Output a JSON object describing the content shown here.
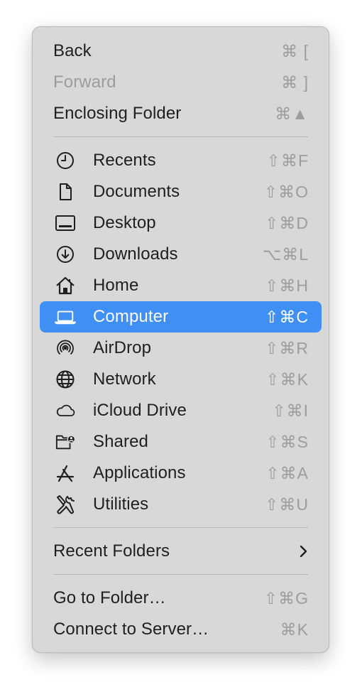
{
  "colors": {
    "menu_background": "#d8d8d8",
    "selection": "#3f8ff4",
    "text": "#1f1f1f",
    "disabled_text": "#9d9d9d",
    "separator": "#b9b9b9"
  },
  "nav": {
    "back": {
      "label": "Back",
      "shortcut": "⌘ ["
    },
    "forward": {
      "label": "Forward",
      "shortcut": "⌘ ]"
    },
    "enclosing": {
      "label": "Enclosing Folder",
      "shortcut": "⌘▲"
    }
  },
  "places": [
    {
      "label": "Recents",
      "shortcut": "⇧⌘F",
      "icon": "clock-icon"
    },
    {
      "label": "Documents",
      "shortcut": "⇧⌘O",
      "icon": "document-icon"
    },
    {
      "label": "Desktop",
      "shortcut": "⇧⌘D",
      "icon": "desktop-icon"
    },
    {
      "label": "Downloads",
      "shortcut": "⌥⌘L",
      "icon": "download-icon"
    },
    {
      "label": "Home",
      "shortcut": "⇧⌘H",
      "icon": "home-icon"
    },
    {
      "label": "Computer",
      "shortcut": "⇧⌘C",
      "icon": "laptop-icon",
      "selected": true
    },
    {
      "label": "AirDrop",
      "shortcut": "⇧⌘R",
      "icon": "airdrop-icon"
    },
    {
      "label": "Network",
      "shortcut": "⇧⌘K",
      "icon": "globe-icon"
    },
    {
      "label": "iCloud Drive",
      "shortcut": "⇧⌘I",
      "icon": "cloud-icon"
    },
    {
      "label": "Shared",
      "shortcut": "⇧⌘S",
      "icon": "shared-folder-icon"
    },
    {
      "label": "Applications",
      "shortcut": "⇧⌘A",
      "icon": "applications-icon"
    },
    {
      "label": "Utilities",
      "shortcut": "⇧⌘U",
      "icon": "tools-icon"
    }
  ],
  "recent_folders": {
    "label": "Recent Folders",
    "icon": "chevron-right-icon"
  },
  "go": {
    "go_to_folder": {
      "label": "Go to Folder…",
      "shortcut": "⇧⌘G"
    },
    "connect": {
      "label": "Connect to Server…",
      "shortcut": "⌘K"
    }
  }
}
